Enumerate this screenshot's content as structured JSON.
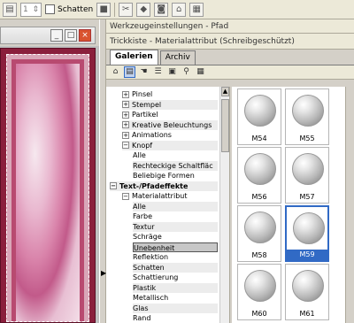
{
  "toolbar": {
    "spin_value": "1",
    "shadow_label": "Schatten"
  },
  "panel": {
    "title_path": "Werkzeugeinstellungen - Pfad",
    "title_materials": "Trickkiste - Materialattribut (Schreibgeschützt)",
    "tabs": [
      {
        "label": "Galerien"
      },
      {
        "label": "Archiv"
      }
    ]
  },
  "tree": [
    {
      "label": "Pinsel",
      "level": 1,
      "pm": "+"
    },
    {
      "label": "Stempel",
      "level": 1,
      "pm": "+"
    },
    {
      "label": "Partikel",
      "level": 1,
      "pm": "+"
    },
    {
      "label": "Kreative Beleuchtungs",
      "level": 1,
      "pm": "+"
    },
    {
      "label": "Animations",
      "level": 1,
      "pm": "+"
    },
    {
      "label": "Knopf",
      "level": 1,
      "pm": "−"
    },
    {
      "label": "Alle",
      "level": 2
    },
    {
      "label": "Rechteckige Schaltfläc",
      "level": 2
    },
    {
      "label": "Beliebige Formen",
      "level": 2
    },
    {
      "label": "Text-/Pfadeffekte",
      "level": 0,
      "pm": "−",
      "bold": true
    },
    {
      "label": "Materialattribut",
      "level": 1,
      "pm": "−"
    },
    {
      "label": "Alle",
      "level": 2
    },
    {
      "label": "Farbe",
      "level": 2
    },
    {
      "label": "Textur",
      "level": 2
    },
    {
      "label": "Schräge",
      "level": 2
    },
    {
      "label": "Unebenheit",
      "level": 2,
      "selected": true
    },
    {
      "label": "Reflektion",
      "level": 2
    },
    {
      "label": "Schatten",
      "level": 2
    },
    {
      "label": "Schattierung",
      "level": 2
    },
    {
      "label": "Plastik",
      "level": 2
    },
    {
      "label": "Metallisch",
      "level": 2
    },
    {
      "label": "Glas",
      "level": 2
    },
    {
      "label": "Rand",
      "level": 2
    }
  ],
  "thumbnails": [
    {
      "label": "M54"
    },
    {
      "label": "M55"
    },
    {
      "label": "M56"
    },
    {
      "label": "M57"
    },
    {
      "label": "M58"
    },
    {
      "label": "M59",
      "selected": true
    },
    {
      "label": "M60"
    },
    {
      "label": "M61"
    }
  ]
}
